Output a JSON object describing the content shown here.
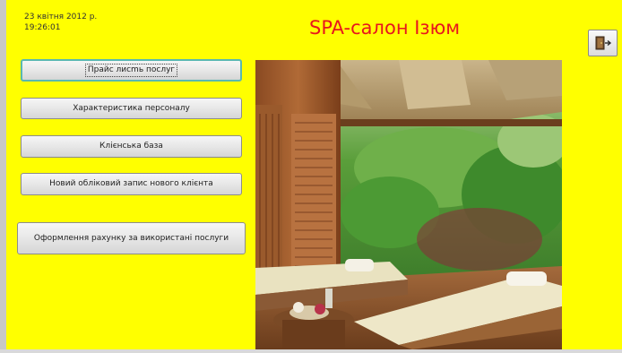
{
  "header": {
    "date": "23 квітня 2012 р.",
    "time": "19:26:01",
    "title": "SPA-салон Ізюм"
  },
  "toolbar": {
    "exit_icon": "exit-door-icon"
  },
  "menu": {
    "price_list": "Прайс лисmь послуг",
    "staff": "Характеристика персоналу",
    "clients": "Клієнська база",
    "new_client": "Новий обліковий запис нового клієнта",
    "invoice": "Оформлення рахунку за використані послуги"
  },
  "colors": {
    "background": "#ffff00",
    "title": "#e8161d"
  }
}
